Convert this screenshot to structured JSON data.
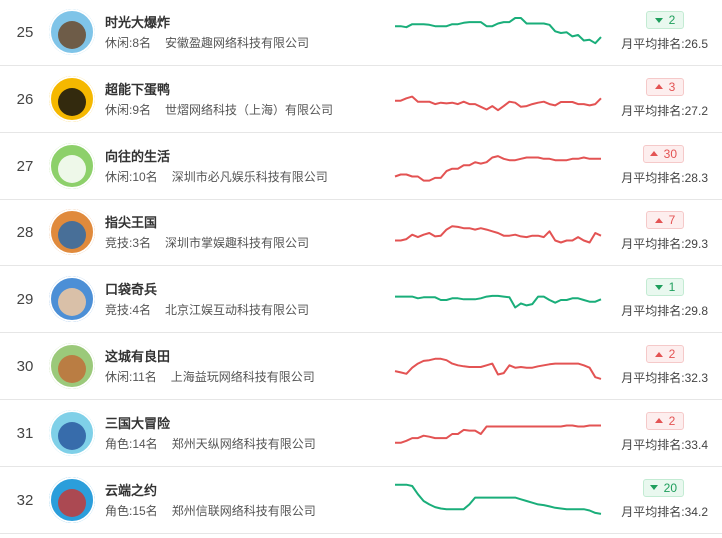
{
  "avg_prefix": "月平均排名:",
  "colors": {
    "up": "#e35353",
    "down": "#1aae7a"
  },
  "games": [
    {
      "rank": "25",
      "name": "时光大爆炸",
      "category": "休闲:8名",
      "company": "安徽盈趣网络科技有限公司",
      "change": "2",
      "direction": "down",
      "avg": "26.5",
      "trend": [
        0.3,
        0.3,
        0.33,
        0.24,
        0.24,
        0.24,
        0.26,
        0.3,
        0.3,
        0.3,
        0.24,
        0.24,
        0.2,
        0.18,
        0.18,
        0.18,
        0.3,
        0.3,
        0.22,
        0.18,
        0.18,
        0.06,
        0.06,
        0.22,
        0.22,
        0.22,
        0.22,
        0.26,
        0.45,
        0.5,
        0.48,
        0.6,
        0.56,
        0.72,
        0.7,
        0.8,
        0.62
      ],
      "avatar_bg": "#7fc4e8",
      "avatar_fg": "#6b4a2c"
    },
    {
      "rank": "26",
      "name": "超能下蛋鸭",
      "category": "休闲:9名",
      "company": "世熠网络科技（上海）有限公司",
      "change": "3",
      "direction": "up",
      "avg": "27.2",
      "trend": [
        0.52,
        0.52,
        0.45,
        0.4,
        0.55,
        0.55,
        0.55,
        0.62,
        0.58,
        0.6,
        0.58,
        0.62,
        0.55,
        0.62,
        0.62,
        0.7,
        0.78,
        0.68,
        0.8,
        0.68,
        0.55,
        0.58,
        0.7,
        0.68,
        0.62,
        0.58,
        0.55,
        0.62,
        0.66,
        0.56,
        0.56,
        0.56,
        0.62,
        0.62,
        0.66,
        0.62,
        0.45
      ],
      "avatar_bg": "#f5b800",
      "avatar_fg": "#111111"
    },
    {
      "rank": "27",
      "name": "向往的生活",
      "category": "休闲:10名",
      "company": "深圳市必凡娱乐科技有限公司",
      "change": "30",
      "direction": "up",
      "avg": "28.3",
      "trend": [
        0.78,
        0.72,
        0.72,
        0.78,
        0.78,
        0.9,
        0.9,
        0.82,
        0.82,
        0.62,
        0.55,
        0.55,
        0.45,
        0.45,
        0.36,
        0.4,
        0.36,
        0.22,
        0.18,
        0.26,
        0.3,
        0.3,
        0.26,
        0.22,
        0.22,
        0.22,
        0.26,
        0.26,
        0.3,
        0.3,
        0.3,
        0.26,
        0.26,
        0.22,
        0.26,
        0.26,
        0.26
      ],
      "avatar_bg": "#8dd06a",
      "avatar_fg": "#ffffff"
    },
    {
      "rank": "28",
      "name": "指尖王国",
      "category": "竞技:3名",
      "company": "深圳市掌娱趣科技有限公司",
      "change": "7",
      "direction": "up",
      "avg": "29.3",
      "trend": [
        0.72,
        0.72,
        0.68,
        0.55,
        0.62,
        0.55,
        0.5,
        0.6,
        0.58,
        0.4,
        0.3,
        0.32,
        0.36,
        0.36,
        0.4,
        0.36,
        0.4,
        0.45,
        0.5,
        0.58,
        0.58,
        0.55,
        0.6,
        0.62,
        0.58,
        0.58,
        0.62,
        0.45,
        0.72,
        0.78,
        0.72,
        0.72,
        0.62,
        0.72,
        0.78,
        0.5,
        0.58
      ],
      "avatar_bg": "#e08a3c",
      "avatar_fg": "#2d6aa8"
    },
    {
      "rank": "29",
      "name": "口袋奇兵",
      "category": "竞技:4名",
      "company": "北京江娱互动科技有限公司",
      "change": "1",
      "direction": "down",
      "avg": "29.8",
      "trend": [
        0.4,
        0.4,
        0.4,
        0.4,
        0.45,
        0.42,
        0.42,
        0.42,
        0.5,
        0.5,
        0.45,
        0.45,
        0.48,
        0.48,
        0.48,
        0.45,
        0.4,
        0.38,
        0.38,
        0.4,
        0.42,
        0.72,
        0.6,
        0.66,
        0.62,
        0.4,
        0.4,
        0.5,
        0.58,
        0.5,
        0.5,
        0.45,
        0.45,
        0.5,
        0.55,
        0.55,
        0.48
      ],
      "avatar_bg": "#4c8fd6",
      "avatar_fg": "#f2c9a0"
    },
    {
      "rank": "30",
      "name": "这城有良田",
      "category": "休闲:11名",
      "company": "上海益玩网络科技有限公司",
      "change": "2",
      "direction": "up",
      "avg": "32.3",
      "trend": [
        0.62,
        0.66,
        0.7,
        0.52,
        0.4,
        0.32,
        0.3,
        0.26,
        0.26,
        0.3,
        0.4,
        0.45,
        0.48,
        0.5,
        0.5,
        0.5,
        0.45,
        0.4,
        0.72,
        0.68,
        0.45,
        0.52,
        0.5,
        0.52,
        0.52,
        0.48,
        0.45,
        0.42,
        0.4,
        0.4,
        0.4,
        0.4,
        0.4,
        0.45,
        0.52,
        0.8,
        0.85
      ],
      "avatar_bg": "#9bc97a",
      "avatar_fg": "#c0703a"
    },
    {
      "rank": "31",
      "name": "三国大冒险",
      "category": "角色:14名",
      "company": "郑州天纵网络科技有限公司",
      "change": "2",
      "direction": "up",
      "avg": "33.4",
      "trend": [
        0.76,
        0.76,
        0.7,
        0.62,
        0.62,
        0.55,
        0.58,
        0.62,
        0.62,
        0.62,
        0.5,
        0.5,
        0.38,
        0.4,
        0.4,
        0.5,
        0.28,
        0.28,
        0.28,
        0.28,
        0.28,
        0.28,
        0.28,
        0.28,
        0.28,
        0.28,
        0.28,
        0.28,
        0.28,
        0.28,
        0.25,
        0.25,
        0.28,
        0.28,
        0.25,
        0.25,
        0.25
      ],
      "avatar_bg": "#7fd0e8",
      "avatar_fg": "#2a5aa0"
    },
    {
      "rank": "32",
      "name": "云端之约",
      "category": "角色:15名",
      "company": "郑州信联网络科技有限公司",
      "change": "20",
      "direction": "down",
      "avg": "34.2",
      "trend": [
        0.02,
        0.02,
        0.02,
        0.06,
        0.3,
        0.5,
        0.6,
        0.68,
        0.72,
        0.74,
        0.74,
        0.74,
        0.74,
        0.6,
        0.4,
        0.4,
        0.4,
        0.4,
        0.4,
        0.4,
        0.4,
        0.4,
        0.45,
        0.5,
        0.55,
        0.6,
        0.62,
        0.66,
        0.7,
        0.72,
        0.74,
        0.74,
        0.74,
        0.74,
        0.78,
        0.85,
        0.88
      ],
      "avatar_bg": "#2b9edb",
      "avatar_fg": "#c23a3a"
    }
  ]
}
